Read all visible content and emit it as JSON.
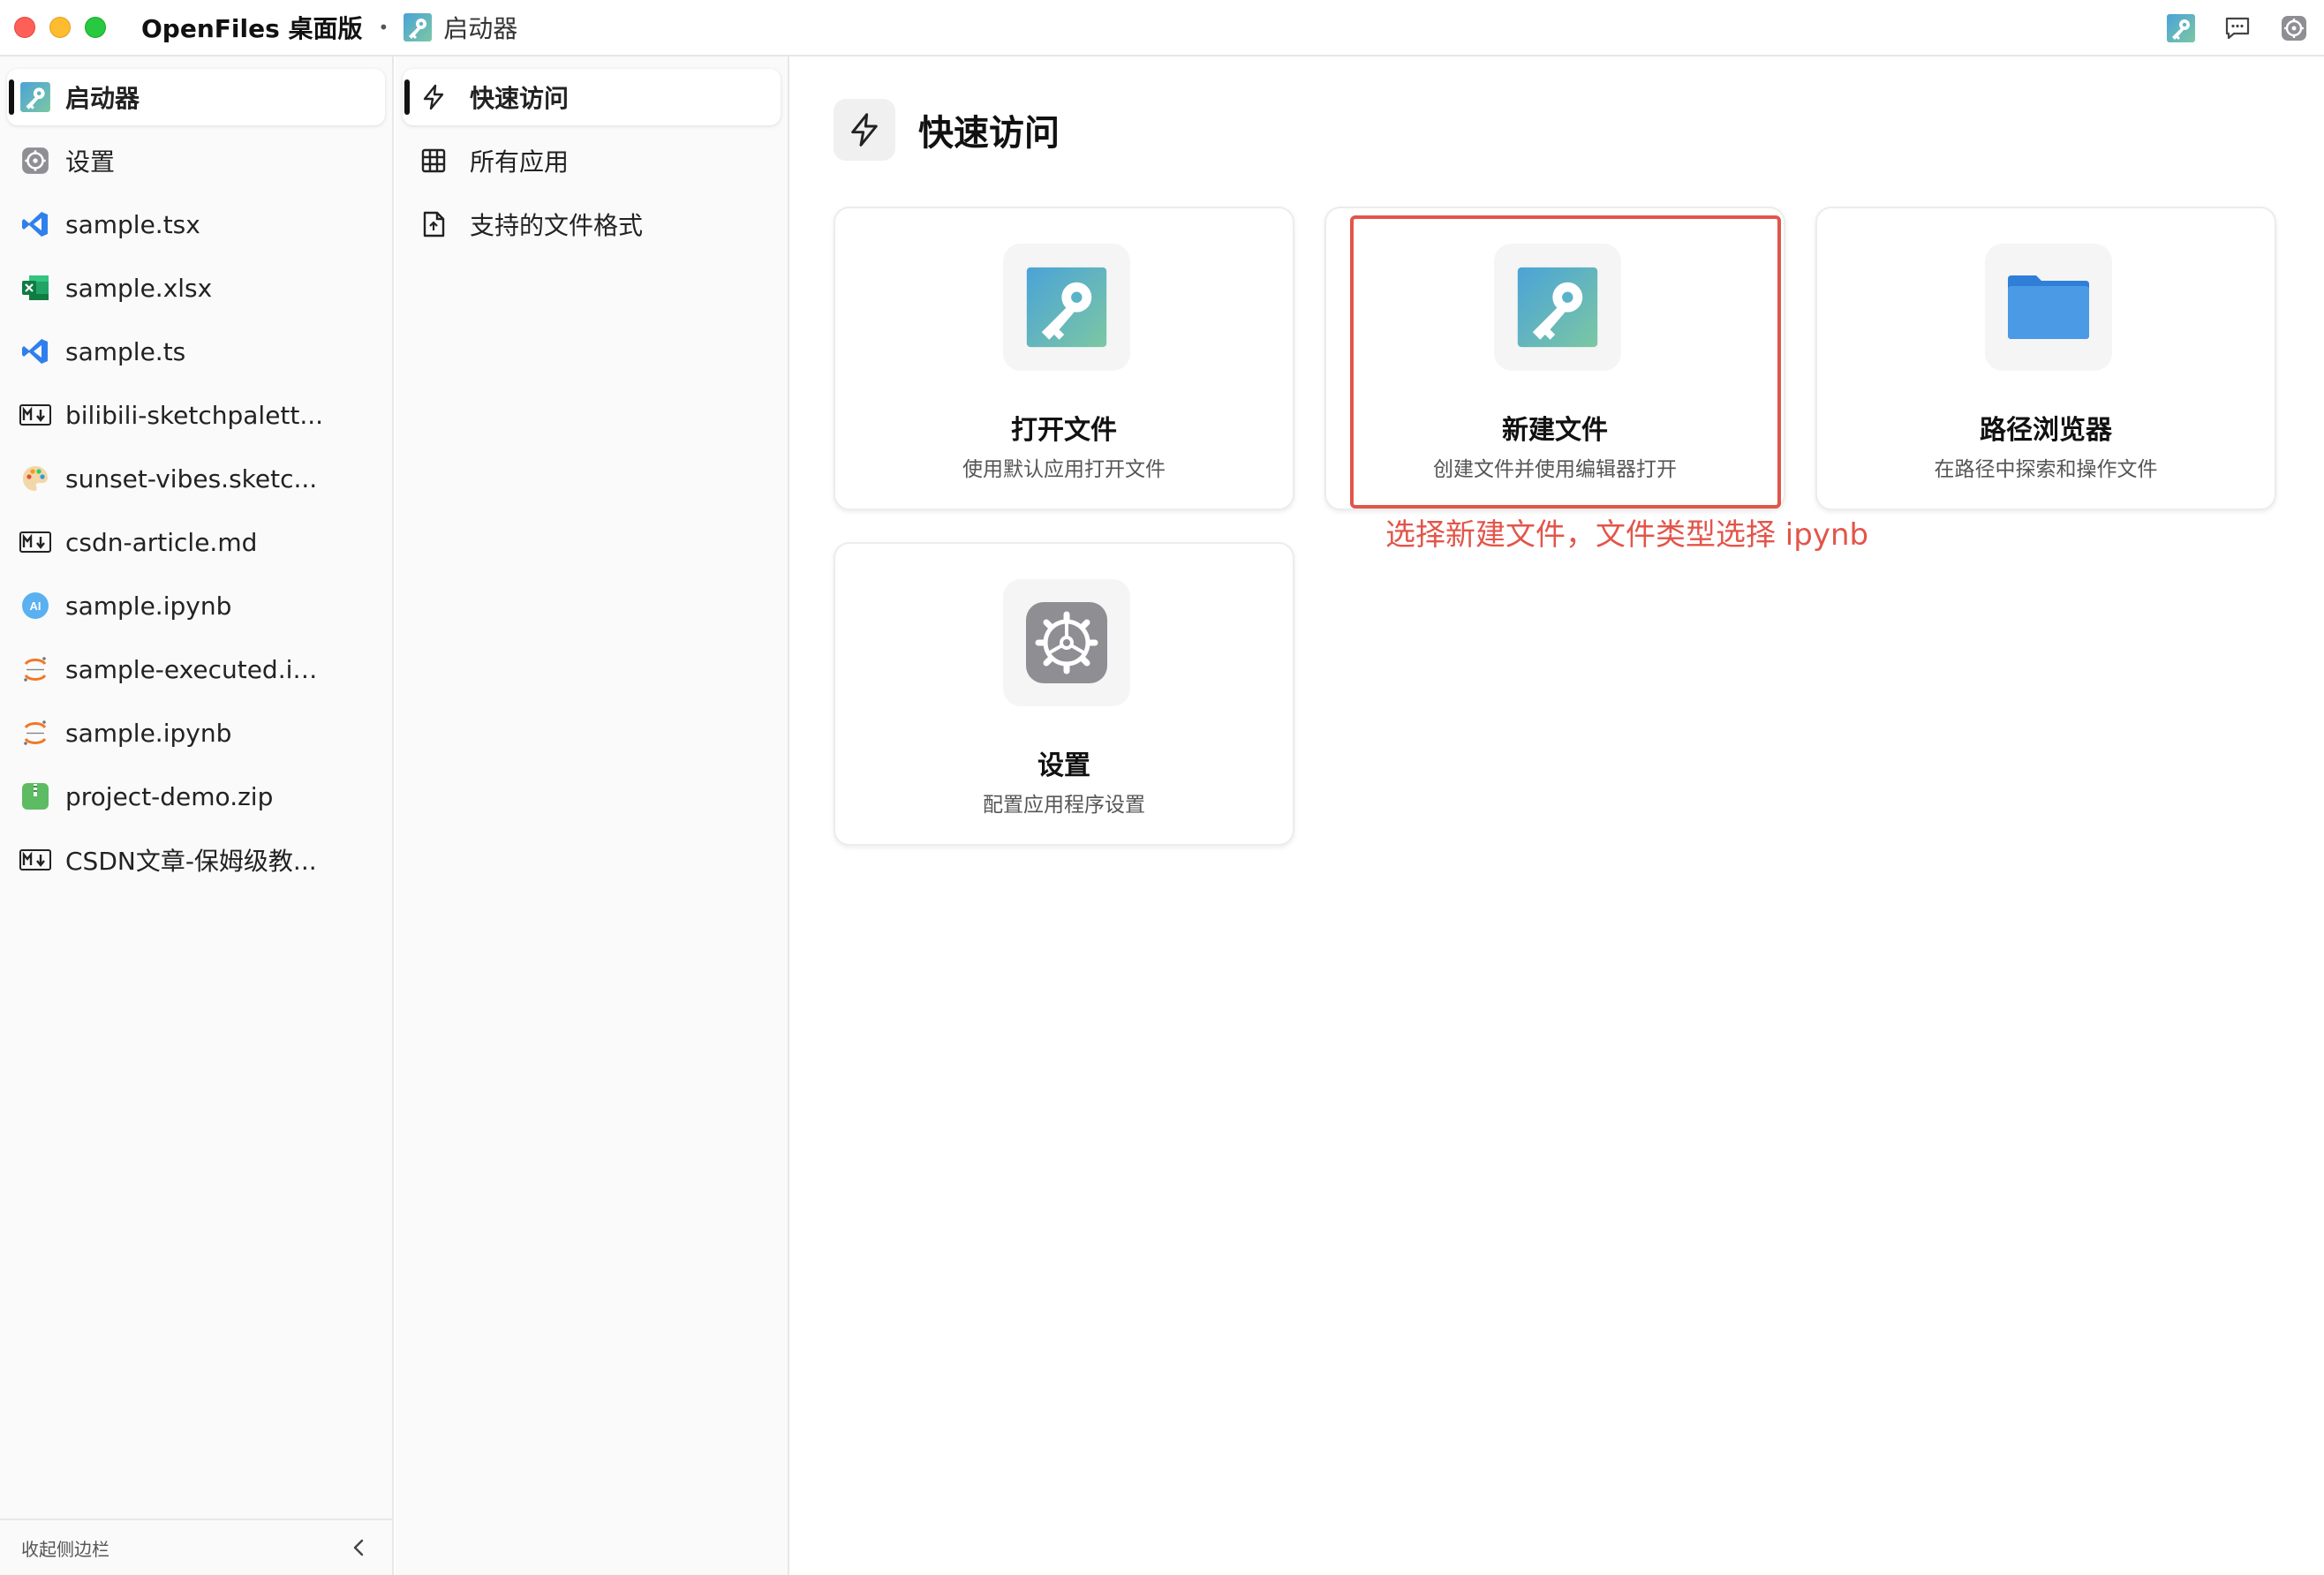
{
  "window": {
    "app_title": "OpenFiles 桌面版",
    "separator": "•",
    "active_tab": "启动器"
  },
  "sidebar": {
    "items": [
      {
        "label": "启动器",
        "icon": "key-app-icon",
        "active": true
      },
      {
        "label": "设置",
        "icon": "gear-icon"
      },
      {
        "label": "sample.tsx",
        "icon": "vscode-icon"
      },
      {
        "label": "sample.xlsx",
        "icon": "excel-icon"
      },
      {
        "label": "sample.ts",
        "icon": "vscode-icon"
      },
      {
        "label": "bilibili-sketchpalett...",
        "icon": "markdown-icon"
      },
      {
        "label": "sunset-vibes.sketc...",
        "icon": "palette-icon"
      },
      {
        "label": "csdn-article.md",
        "icon": "markdown-icon"
      },
      {
        "label": "sample.ipynb",
        "icon": "ai-icon"
      },
      {
        "label": "sample-executed.ip...",
        "icon": "jupyter-icon"
      },
      {
        "label": "sample.ipynb",
        "icon": "jupyter-icon"
      },
      {
        "label": "project-demo.zip",
        "icon": "zip-icon"
      },
      {
        "label": "CSDN文章-保姆级教...",
        "icon": "markdown-icon"
      }
    ],
    "collapse_label": "收起侧边栏"
  },
  "nav": {
    "items": [
      {
        "label": "快速访问",
        "icon": "lightning-icon",
        "active": true
      },
      {
        "label": "所有应用",
        "icon": "grid-icon"
      },
      {
        "label": "支持的文件格式",
        "icon": "file-icon"
      }
    ]
  },
  "main": {
    "title": "快速访问",
    "cards": [
      {
        "title": "打开文件",
        "desc": "使用默认应用打开文件",
        "icon": "key-app-icon"
      },
      {
        "title": "新建文件",
        "desc": "创建文件并使用编辑器打开",
        "icon": "key-app-icon"
      },
      {
        "title": "路径浏览器",
        "desc": "在路径中探索和操作文件",
        "icon": "folder-icon"
      },
      {
        "title": "设置",
        "desc": "配置应用程序设置",
        "icon": "settings-gear-icon"
      }
    ]
  },
  "annotation": {
    "text": "选择新建文件，文件类型选择 ipynb",
    "color": "#e2554a"
  }
}
